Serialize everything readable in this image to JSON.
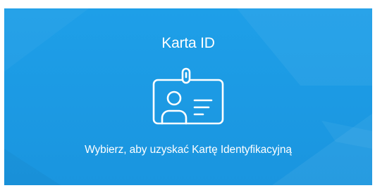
{
  "card": {
    "title": "Karta ID",
    "description": "Wybierz, aby uzyskać Kartę Identyfikacyjną",
    "icon": "id-card-icon"
  },
  "colors": {
    "background": "#1d9be4",
    "foreground": "#ffffff"
  }
}
